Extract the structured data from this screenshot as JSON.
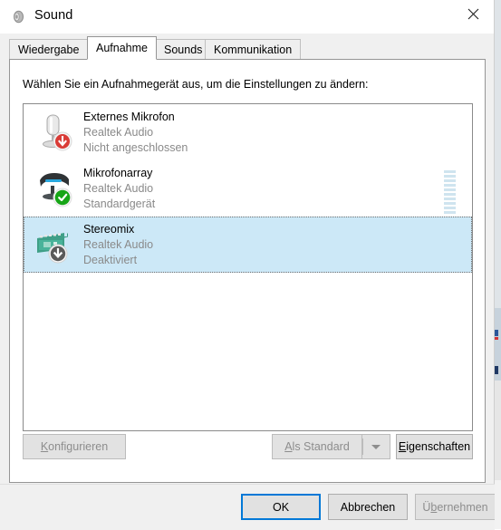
{
  "window": {
    "title": "Sound",
    "icon": "speaker-icon",
    "close_label": "✕"
  },
  "tabs": [
    {
      "label": "Wiedergabe",
      "selected": false
    },
    {
      "label": "Aufnahme",
      "selected": true
    },
    {
      "label": "Sounds",
      "selected": false
    },
    {
      "label": "Kommunikation",
      "selected": false
    }
  ],
  "panel": {
    "instruction": "Wählen Sie ein Aufnahmegerät aus, um die Einstellungen zu ändern:"
  },
  "devices": [
    {
      "name": "Externes Mikrofon",
      "driver": "Realtek Audio",
      "status": "Nicht angeschlossen",
      "icon": "microphone-icon",
      "badge": "red-down-arrow-badge",
      "selected": false,
      "meter_segments": 0
    },
    {
      "name": "Mikrofonarray",
      "driver": "Realtek Audio",
      "status": "Standardgerät",
      "icon": "microphone-array-icon",
      "badge": "green-check-badge",
      "selected": false,
      "meter_segments": 10
    },
    {
      "name": "Stereomix",
      "driver": "Realtek Audio",
      "status": "Deaktiviert",
      "icon": "sound-card-icon",
      "badge": "grey-down-arrow-badge",
      "selected": true,
      "meter_segments": 0
    }
  ],
  "buttons": {
    "configure": {
      "label": "Konfigurieren",
      "accel": "K",
      "enabled": false
    },
    "set_default": {
      "label": "Als Standard",
      "accel": "A",
      "enabled": false
    },
    "set_default_arrow": {
      "icon": "chevron-down-icon",
      "enabled": false
    },
    "properties": {
      "label": "Eigenschaften",
      "accel": "E",
      "enabled": true
    },
    "ok": {
      "label": "OK",
      "enabled": true,
      "default": true
    },
    "cancel": {
      "label": "Abbrechen",
      "enabled": true
    },
    "apply": {
      "label": "Übernehmen",
      "accel": "b",
      "enabled": false
    }
  },
  "colors": {
    "selection": "#cce8f7",
    "focus_border": "#0078d7",
    "meter": "#cfe4ef",
    "status_ok": "#17a81a",
    "status_error": "#d13438",
    "disabled_text": "#8d8d8d"
  }
}
